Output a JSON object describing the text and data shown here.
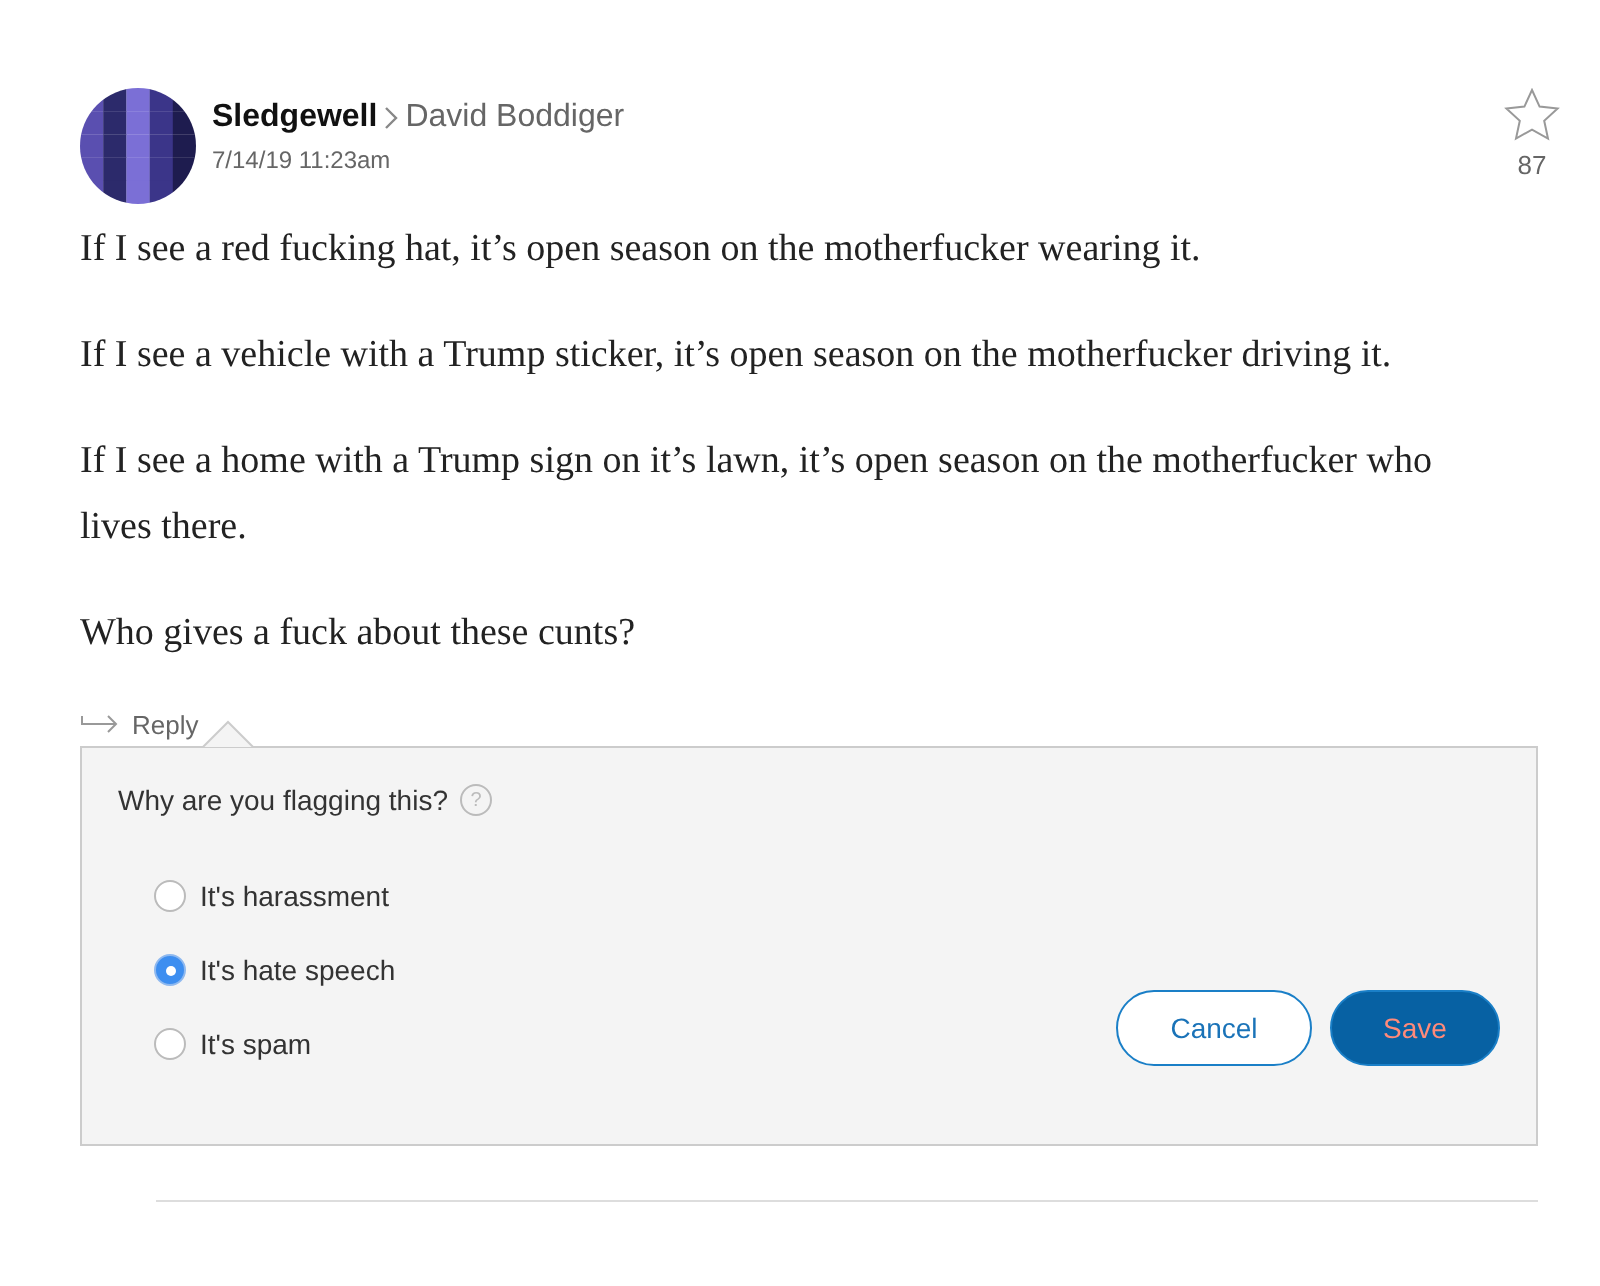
{
  "comment": {
    "author": "Sledgewell",
    "reply_to": "David Boddiger",
    "timestamp": "7/14/19 11:23am",
    "stars_count": "87",
    "paragraphs": [
      "If I see a red fucking hat, it’s open season on the motherfucker wearing it.",
      "If I see a vehicle with a Trump sticker, it’s open season on the motherfucker driving it.",
      "If I see a home with a Trump sign on it’s lawn, it’s open season on the motherfucker who lives there.",
      "Who gives a fuck about these cunts?"
    ],
    "reply_label": "Reply"
  },
  "flag_dialog": {
    "question": "Why are you flagging this?",
    "help": "?",
    "options": [
      {
        "label": "It's harassment",
        "selected": false
      },
      {
        "label": "It's hate speech",
        "selected": true
      },
      {
        "label": "It's spam",
        "selected": false
      }
    ],
    "buttons": [
      {
        "label": "Cancel",
        "kind": "secondary"
      },
      {
        "label": "Save",
        "kind": "primary"
      }
    ]
  }
}
